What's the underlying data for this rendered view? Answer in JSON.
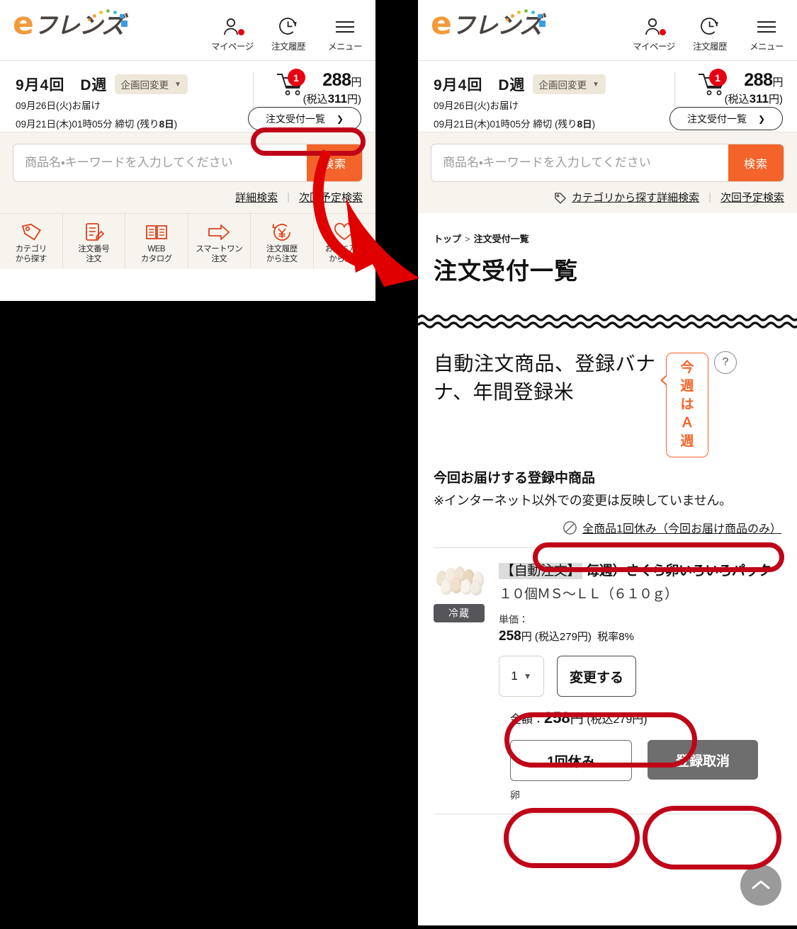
{
  "brand": {
    "logo_e": "e",
    "logo_kana": "フレンズ"
  },
  "header": {
    "icons": [
      {
        "name": "my-page",
        "label": "マイページ"
      },
      {
        "name": "order-history",
        "label": "注文履歴"
      },
      {
        "name": "menu",
        "label": "メニュー"
      }
    ]
  },
  "delivery": {
    "cycle": "9月4回　D週",
    "change_chip": "企画回変更",
    "delivery_date": "09月26日(火)お届け",
    "deadline_prefix": "09月21日(木)01時05分 締切 (残り",
    "deadline_days": "8日",
    "deadline_suffix": ")",
    "cart_count": "1",
    "price": "288",
    "price_yen": "円",
    "price_tax_prefix": "(税込",
    "price_tax": "311",
    "price_tax_suffix": "円)",
    "order_list_button": "注文受付一覧"
  },
  "search": {
    "placeholder": "商品名・キーワードを入力してください",
    "button": "検索",
    "link_detail": "カテゴリから探す詳細検索",
    "link_detail_short": "詳細検索",
    "link_next": "次回予定検索",
    "divider": "|"
  },
  "quicknav": [
    {
      "label": "カテゴリ\nから探す",
      "icon": "tag-icon"
    },
    {
      "label": "注文番号\n注文",
      "icon": "order-number-icon"
    },
    {
      "label": "WEB\nカタログ",
      "icon": "catalog-icon"
    },
    {
      "label": "スマートワン\n注文",
      "icon": "arrow-right-icon"
    },
    {
      "label": "注文履歴\nから注文",
      "icon": "yen-refresh-icon"
    },
    {
      "label": "お気に入り\nから注文",
      "icon": "heart-icon"
    }
  ],
  "breadcrumb": {
    "home": "トップ",
    "separator": ">",
    "current": "注文受付一覧"
  },
  "page_title": "注文受付一覧",
  "section": {
    "title": "自動注文商品、登録バナナ、年間登録米",
    "week_badge": "今週\nはＡ\n週",
    "week_badge_lines": [
      "今週",
      "はＡ",
      "週"
    ],
    "help": "?",
    "subtitle": "今回お届けする登録中商品",
    "note": "※インターネット以外での変更は反映していません。",
    "rest_all_link": "全商品1回休み（今回お届け商品のみ）"
  },
  "product": {
    "tag": "【自動注文】",
    "name": "毎週）さくら卵いろいろパック",
    "spec": "１０個ＭＳ～ＬＬ（６１０ｇ）",
    "cold_badge": "冷蔵",
    "unit_label": "単価：",
    "unit_price": "258",
    "unit_price_yen": "円",
    "unit_price_tax": "(税込279円)",
    "tax_rate": "税率8%",
    "qty_value": "1",
    "change_button": "変更する",
    "amount_label": "金額：",
    "amount_value": "258",
    "amount_yen": "円",
    "amount_tax": "(税込279円)",
    "rest_button": "1回休み",
    "cancel_button": "登録取消",
    "allergy": "卵"
  },
  "scroll_top": "^",
  "colors": {
    "brand_orange": "#F4642A",
    "logo_orange": "#F29A3B",
    "annotation_red": "#C00418",
    "badge_red": "#E60012",
    "band_beige": "#F7F4EE",
    "chip_beige": "#EDE7DA",
    "cancel_gray": "#6E6E6E",
    "cold_gray": "#55555A"
  }
}
